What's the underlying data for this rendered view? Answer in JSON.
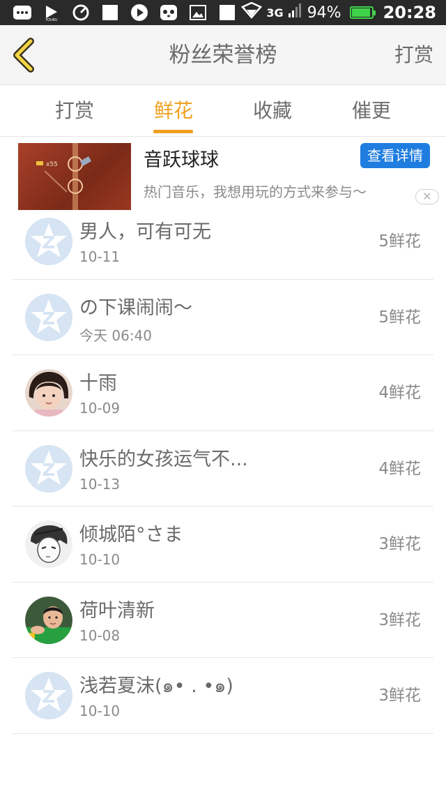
{
  "status_bar": {
    "network": "3G",
    "battery_percent": "94%",
    "battery_level": 0.94,
    "time": "20:28",
    "icons": [
      "message-icon",
      "youku-icon",
      "speedometer-icon",
      "square-icon",
      "video-icon",
      "panda-icon",
      "image-icon",
      "square-icon",
      "wifi-icon",
      "signal-icon"
    ]
  },
  "header": {
    "title": "粉丝荣誉榜",
    "action": "打赏"
  },
  "tabs": [
    {
      "label": "打赏",
      "active": false
    },
    {
      "label": "鲜花",
      "active": true
    },
    {
      "label": "收藏",
      "active": false
    },
    {
      "label": "催更",
      "active": false
    }
  ],
  "ad": {
    "title": "音跃球球",
    "button": "查看详情",
    "description": "热门音乐，我想用玩的方式来参与～",
    "image_text": "x55"
  },
  "fans": [
    {
      "name": "男人，可有可无",
      "date": "10-11",
      "count": "5鲜花",
      "avatar": "default"
    },
    {
      "name": "の下课闹闹～",
      "date": "今天 06:40",
      "count": "5鲜花",
      "avatar": "default"
    },
    {
      "name": "十雨",
      "date": "10-09",
      "count": "4鲜花",
      "avatar": "girl-photo"
    },
    {
      "name": "快乐的女孩运气不...",
      "date": "10-13",
      "count": "4鲜花",
      "avatar": "default"
    },
    {
      "name": "倾城陌°さま",
      "date": "10-10",
      "count": "3鲜花",
      "avatar": "anime-sketch"
    },
    {
      "name": "荷叶清新",
      "date": "10-08",
      "count": "3鲜花",
      "avatar": "boy-photo"
    },
    {
      "name": "浅若夏沫(๑• . •๑)",
      "date": "10-10",
      "count": "3鲜花",
      "avatar": "default"
    }
  ],
  "colors": {
    "accent": "#f0a01e",
    "ad_button": "#1f7de0",
    "default_avatar": "#d6e4f3"
  }
}
